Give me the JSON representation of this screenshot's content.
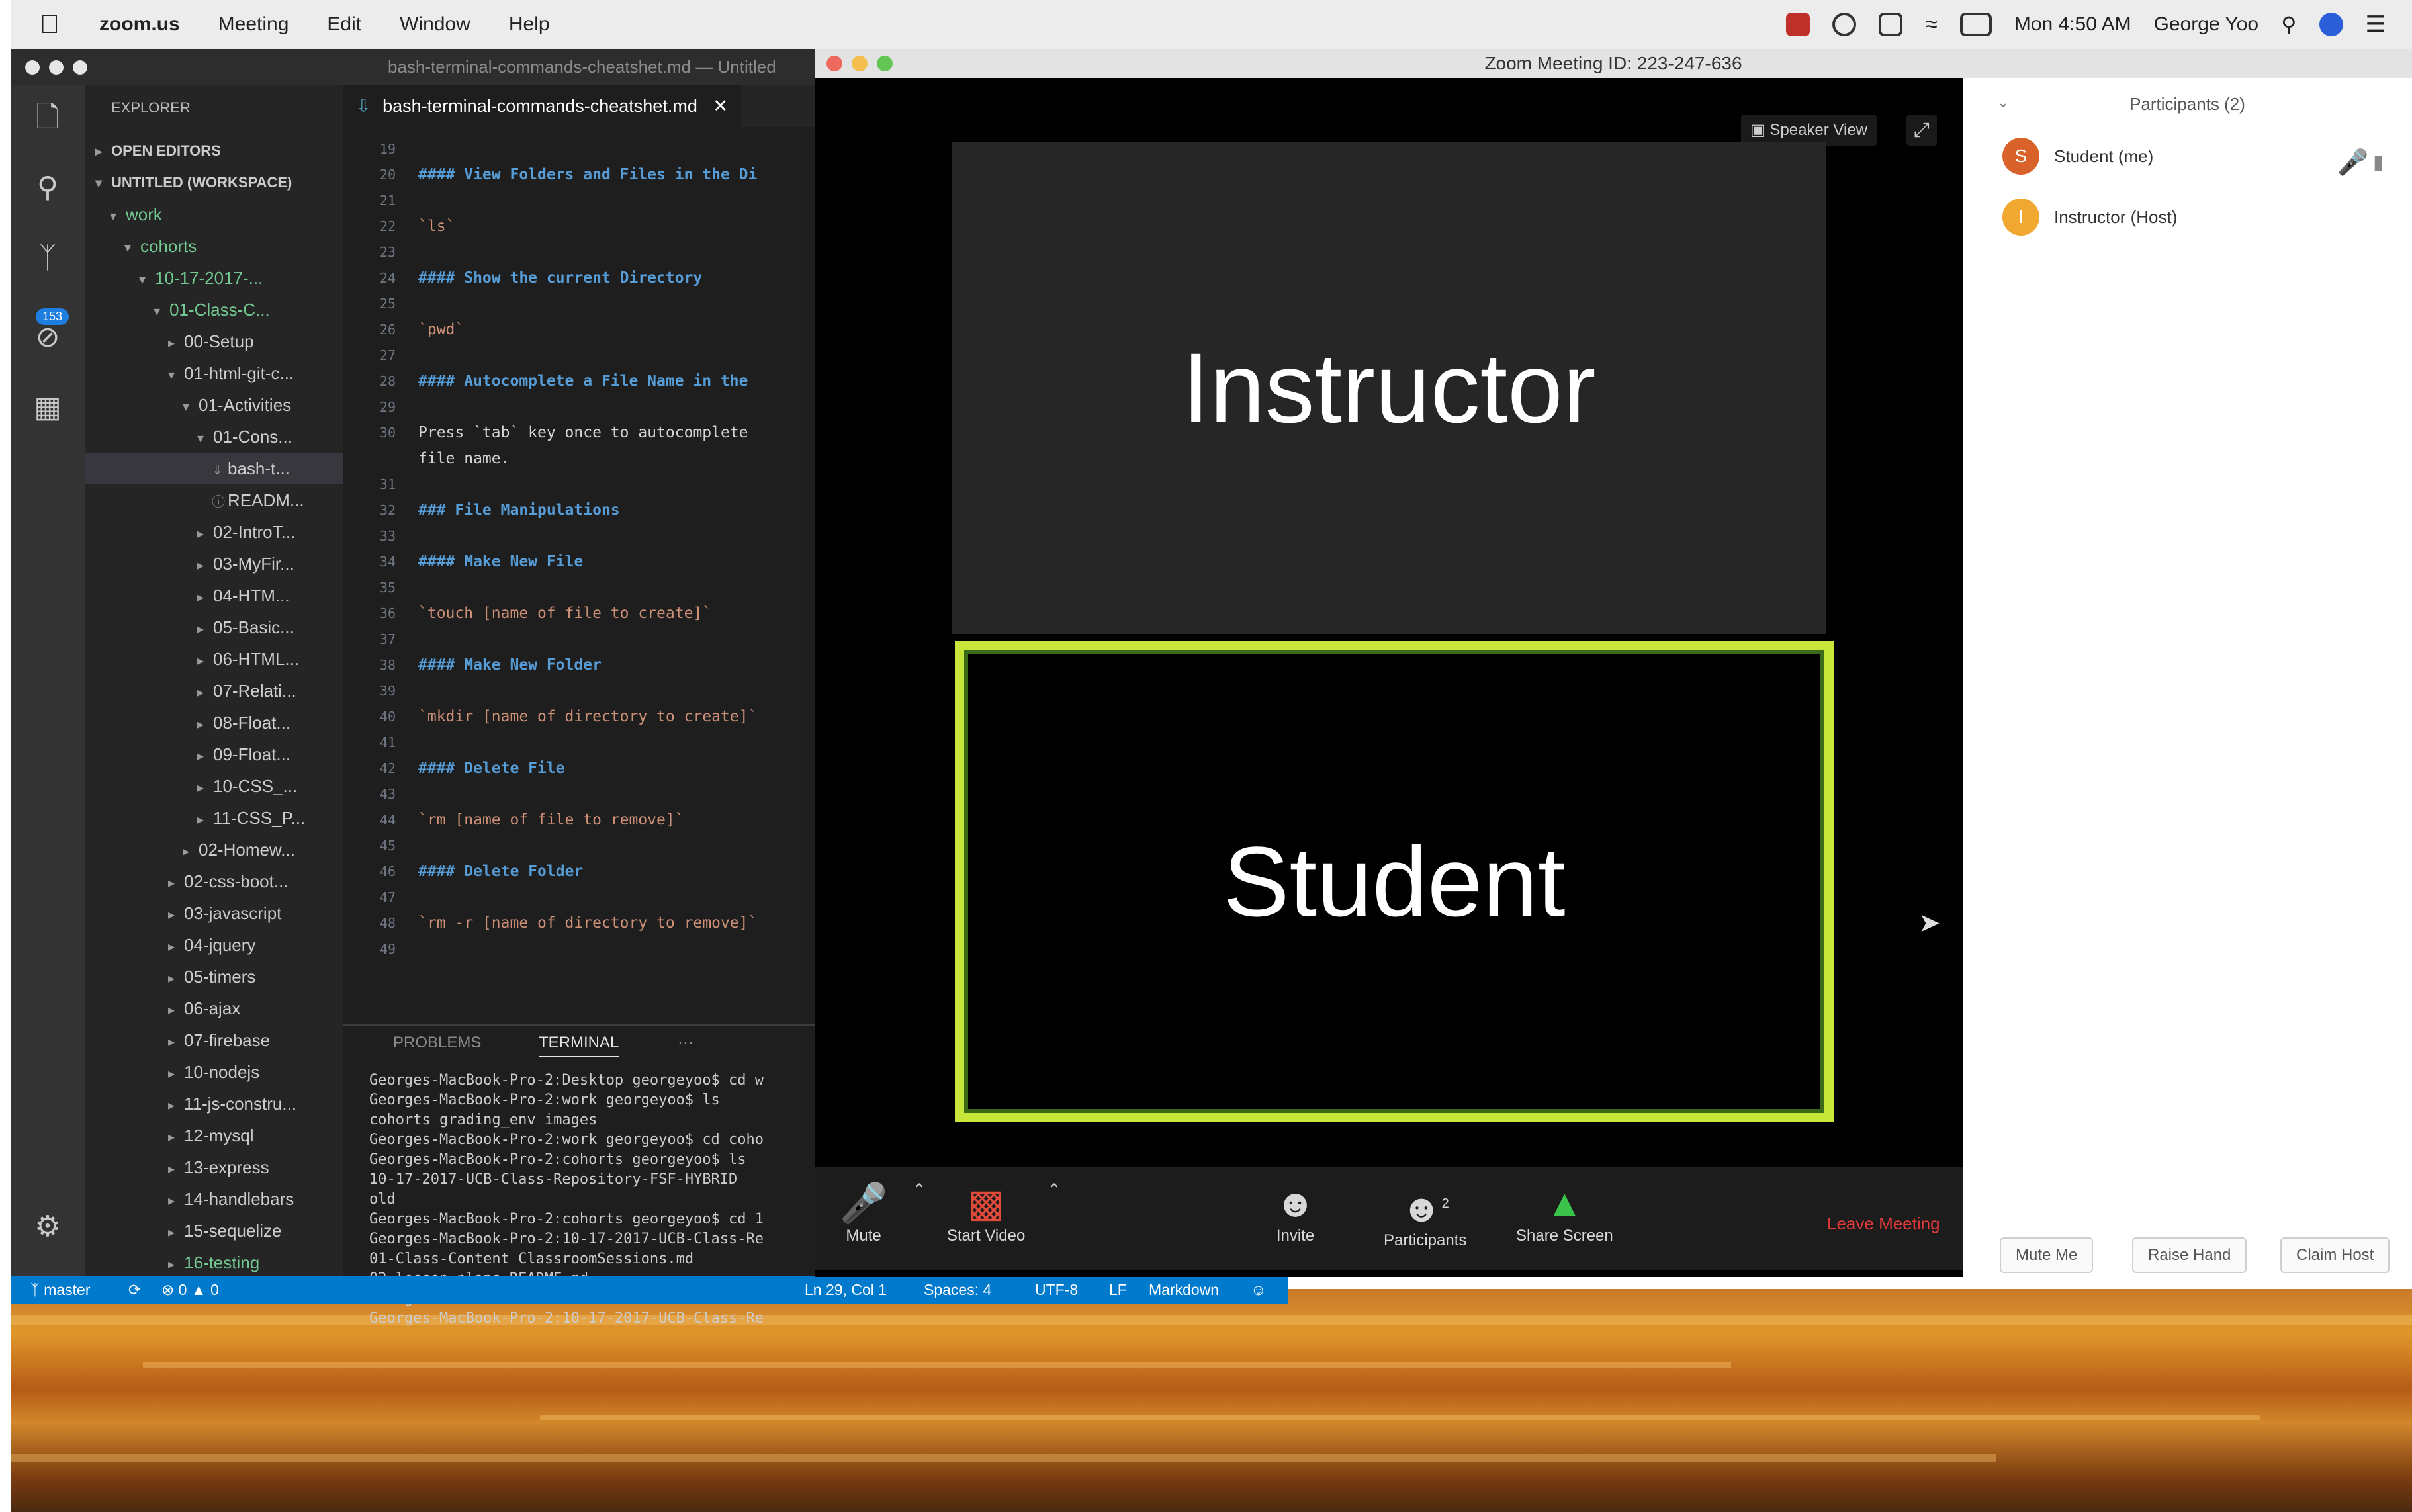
{
  "menubar": {
    "app": "zoom.us",
    "items": [
      "Meeting",
      "Edit",
      "Window",
      "Help"
    ],
    "clock": "Mon 4:50 AM",
    "user": "George Yoo"
  },
  "vscode": {
    "title": "bash-terminal-commands-cheatshet.md — Untitled",
    "scm_badge": "153",
    "explorer_header": "EXPLORER",
    "tree": [
      {
        "label": "OPEN EDITORS",
        "depth": 0,
        "twisty": "▸",
        "bold": true
      },
      {
        "label": "UNTITLED (WORKSPACE)",
        "depth": 0,
        "twisty": "▾",
        "bold": true
      },
      {
        "label": "work",
        "depth": 1,
        "twisty": "▾",
        "green": true
      },
      {
        "label": "cohorts",
        "depth": 2,
        "twisty": "▾",
        "green": true
      },
      {
        "label": "10-17-2017-...",
        "depth": 3,
        "twisty": "▾",
        "green": true
      },
      {
        "label": "01-Class-C...",
        "depth": 4,
        "twisty": "▾",
        "green": true
      },
      {
        "label": "00-Setup",
        "depth": 5,
        "twisty": "▸"
      },
      {
        "label": "01-html-git-c...",
        "depth": 5,
        "twisty": "▾"
      },
      {
        "label": "01-Activities",
        "depth": 6,
        "twisty": "▾"
      },
      {
        "label": "01-Cons...",
        "depth": 7,
        "twisty": "▾"
      },
      {
        "label": "bash-t...",
        "depth": 8,
        "twisty": "⇓",
        "selected": true
      },
      {
        "label": "READM...",
        "depth": 8,
        "twisty": "ⓘ"
      },
      {
        "label": "02-IntroT...",
        "depth": 7,
        "twisty": "▸"
      },
      {
        "label": "03-MyFir...",
        "depth": 7,
        "twisty": "▸"
      },
      {
        "label": "04-HTM...",
        "depth": 7,
        "twisty": "▸"
      },
      {
        "label": "05-Basic...",
        "depth": 7,
        "twisty": "▸"
      },
      {
        "label": "06-HTML...",
        "depth": 7,
        "twisty": "▸"
      },
      {
        "label": "07-Relati...",
        "depth": 7,
        "twisty": "▸"
      },
      {
        "label": "08-Float...",
        "depth": 7,
        "twisty": "▸"
      },
      {
        "label": "09-Float...",
        "depth": 7,
        "twisty": "▸"
      },
      {
        "label": "10-CSS_...",
        "depth": 7,
        "twisty": "▸"
      },
      {
        "label": "11-CSS_P...",
        "depth": 7,
        "twisty": "▸"
      },
      {
        "label": "02-Homew...",
        "depth": 6,
        "twisty": "▸"
      },
      {
        "label": "02-css-boot...",
        "depth": 5,
        "twisty": "▸"
      },
      {
        "label": "03-javascript",
        "depth": 5,
        "twisty": "▸"
      },
      {
        "label": "04-jquery",
        "depth": 5,
        "twisty": "▸"
      },
      {
        "label": "05-timers",
        "depth": 5,
        "twisty": "▸"
      },
      {
        "label": "06-ajax",
        "depth": 5,
        "twisty": "▸"
      },
      {
        "label": "07-firebase",
        "depth": 5,
        "twisty": "▸"
      },
      {
        "label": "10-nodejs",
        "depth": 5,
        "twisty": "▸"
      },
      {
        "label": "11-js-constru...",
        "depth": 5,
        "twisty": "▸"
      },
      {
        "label": "12-mysql",
        "depth": 5,
        "twisty": "▸"
      },
      {
        "label": "13-express",
        "depth": 5,
        "twisty": "▸"
      },
      {
        "label": "14-handlebars",
        "depth": 5,
        "twisty": "▸"
      },
      {
        "label": "15-sequelize",
        "depth": 5,
        "twisty": "▸"
      },
      {
        "label": "16-testing",
        "depth": 5,
        "twisty": "▸",
        "green": true
      }
    ],
    "tab_label": "bash-terminal-commands-cheatshet.md",
    "code": [
      {
        "ln": "19",
        "text": "",
        "kind": "text"
      },
      {
        "ln": "20",
        "text": "#### View Folders and Files in the Di",
        "kind": "head"
      },
      {
        "ln": "21",
        "text": "",
        "kind": "text"
      },
      {
        "ln": "22",
        "text": "`ls`",
        "kind": "code"
      },
      {
        "ln": "23",
        "text": "",
        "kind": "text"
      },
      {
        "ln": "24",
        "text": "#### Show the current Directory",
        "kind": "head"
      },
      {
        "ln": "25",
        "text": "",
        "kind": "text"
      },
      {
        "ln": "26",
        "text": "`pwd`",
        "kind": "code"
      },
      {
        "ln": "27",
        "text": "",
        "kind": "text"
      },
      {
        "ln": "28",
        "text": "#### Autocomplete a File Name in the",
        "kind": "head"
      },
      {
        "ln": "29",
        "text": "",
        "kind": "text"
      },
      {
        "ln": "30",
        "text": "Press `tab` key once to autocomplete",
        "kind": "text"
      },
      {
        "ln": "",
        "text": "file name.",
        "kind": "text"
      },
      {
        "ln": "31",
        "text": "",
        "kind": "text"
      },
      {
        "ln": "32",
        "text": "### File Manipulations",
        "kind": "head"
      },
      {
        "ln": "33",
        "text": "",
        "kind": "text"
      },
      {
        "ln": "34",
        "text": "#### Make New File",
        "kind": "head"
      },
      {
        "ln": "35",
        "text": "",
        "kind": "text"
      },
      {
        "ln": "36",
        "text": "`touch [name of file to create]`",
        "kind": "code"
      },
      {
        "ln": "37",
        "text": "",
        "kind": "text"
      },
      {
        "ln": "38",
        "text": "#### Make New Folder",
        "kind": "head"
      },
      {
        "ln": "39",
        "text": "",
        "kind": "text"
      },
      {
        "ln": "40",
        "text": "`mkdir [name of directory to create]`",
        "kind": "code"
      },
      {
        "ln": "41",
        "text": "",
        "kind": "text"
      },
      {
        "ln": "42",
        "text": "#### Delete File",
        "kind": "head"
      },
      {
        "ln": "43",
        "text": "",
        "kind": "text"
      },
      {
        "ln": "44",
        "text": "`rm [name of file to remove]`",
        "kind": "code"
      },
      {
        "ln": "45",
        "text": "",
        "kind": "text"
      },
      {
        "ln": "46",
        "text": "#### Delete Folder",
        "kind": "head"
      },
      {
        "ln": "47",
        "text": "",
        "kind": "text"
      },
      {
        "ln": "48",
        "text": "`rm -r [name of directory to remove]`",
        "kind": "code"
      },
      {
        "ln": "49",
        "text": "",
        "kind": "text"
      }
    ],
    "panel_tabs": {
      "problems": "PROBLEMS",
      "terminal": "TERMINAL",
      "more": "···"
    },
    "terminal": [
      "Georges-MacBook-Pro-2:Desktop georgeyoo$ cd w",
      "Georges-MacBook-Pro-2:work georgeyoo$ ls",
      "cohorts        grading_env     images",
      "Georges-MacBook-Pro-2:work georgeyoo$ cd coho",
      "Georges-MacBook-Pro-2:cohorts georgeyoo$ ls",
      "10-17-2017-UCB-Class-Repository-FSF-HYBRID",
      "old",
      "Georges-MacBook-Pro-2:cohorts georgeyoo$ cd 1",
      "Georges-MacBook-Pro-2:10-17-2017-UCB-Class-Re",
      "01-Class-Content        ClassroomSessions.md",
      "02-lesson-plans         README.md",
      "Georges-MacBook-Pro-2:10-17-2017-UCB-Class-Re",
      "Georges-MacBook-Pro-2:10-17-2017-UCB-Class-Re"
    ],
    "status": {
      "branch": "master",
      "errors": "0",
      "warnings": "0",
      "position": "Ln 29, Col 1",
      "spaces": "Spaces: 4",
      "encoding": "UTF-8",
      "eol": "LF",
      "language": "Markdown"
    }
  },
  "zoom": {
    "title": "Zoom Meeting ID: 223-247-636",
    "speaker_view": "Speaker View",
    "tiles": {
      "top": "Instructor",
      "bottom": "Student"
    },
    "toolbar": {
      "mute": "Mute",
      "start_video": "Start Video",
      "invite": "Invite",
      "participants": "Participants",
      "participants_count": "2",
      "share_screen": "Share Screen",
      "leave": "Leave Meeting"
    },
    "panel": {
      "title": "Participants (2)",
      "people": [
        {
          "initial": "S",
          "name": "Student (me)",
          "color": "#d9622b"
        },
        {
          "initial": "I",
          "name": "Instructor (Host)",
          "color": "#f0a830"
        }
      ],
      "buttons": {
        "mute_me": "Mute Me",
        "raise_hand": "Raise Hand",
        "claim_host": "Claim Host"
      }
    },
    "accent": "#c8e63a"
  }
}
